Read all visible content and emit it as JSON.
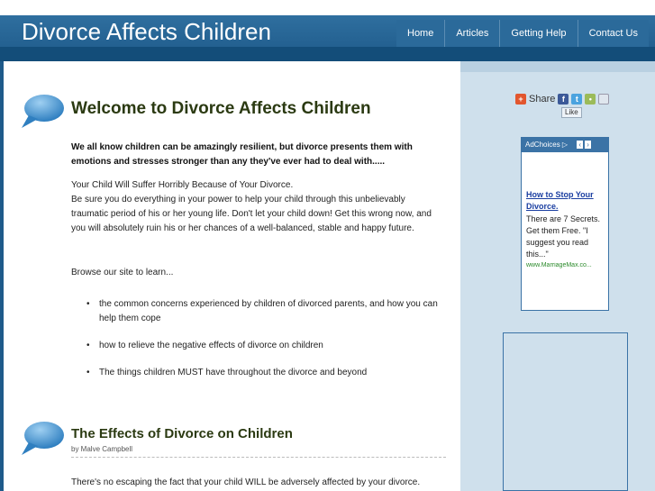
{
  "header": {
    "title": "Divorce Affects Children",
    "nav": [
      "Home",
      "Articles",
      "Getting Help",
      "Contact Us"
    ]
  },
  "main": {
    "heading1": "Welcome to Divorce Affects Children",
    "lead": "We all know children can be amazingly resilient, but divorce presents them with emotions and stresses stronger than any they've ever had to deal with.....",
    "p1": "Your Child Will Suffer Horribly Because of Your Divorce.",
    "p2": "Be sure you do everything in your power to help your child through this unbelievably traumatic period of his or her young life. Don't let your child down! Get this wrong now, and you will absolutely ruin his or her chances of a well-balanced, stable and happy future.",
    "p3": "Browse our site to learn...",
    "bullets": [
      "the common concerns experienced by children of divorced parents, and how you can help them cope",
      "how to relieve the negative effects of divorce on children",
      "The things children MUST have throughout the divorce and beyond"
    ],
    "heading2": "The Effects of Divorce on Children",
    "byline": "by Malve Campbell",
    "p4": "There's no escaping the fact that your child WILL be adversely affected by your divorce."
  },
  "sidebar": {
    "share": "Share",
    "like": "Like",
    "adchoices": "AdChoices",
    "ad_title": "How to Stop Your Divorce.",
    "ad_body": "There are 7 Secrets. Get them Free. \"I suggest you read this...\"",
    "ad_url": "www.MarriageMax.co..."
  },
  "colors": {
    "header": "#1e5a8a",
    "sidebar": "#cfe0ec",
    "heading": "#2b3a12",
    "ad_link": "#1a3ea1"
  }
}
